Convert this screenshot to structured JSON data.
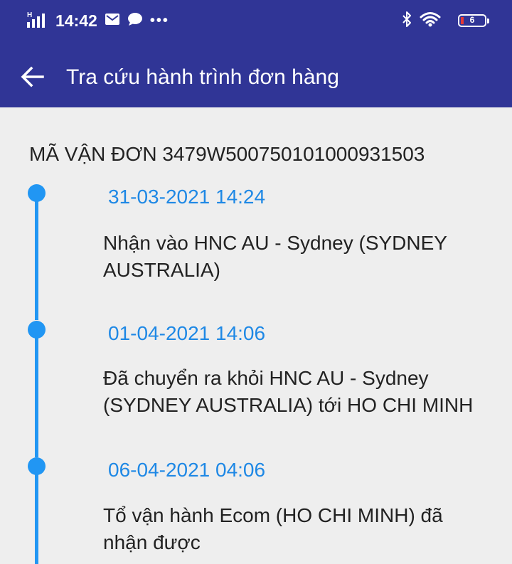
{
  "status_bar": {
    "network_label": "H",
    "time": "14:42",
    "more": "•••",
    "battery_level": "6",
    "icons": [
      "signal-icon",
      "mail-icon",
      "chat-icon",
      "bluetooth-icon",
      "wifi-icon",
      "battery-icon"
    ]
  },
  "app_bar": {
    "title": "Tra cứu hành trình đơn hàng",
    "back_icon": "arrow-left-icon"
  },
  "tracking": {
    "label": "MÃ VẬN ĐƠN 3479W50075010100093150​3"
  },
  "events": [
    {
      "date": "31-03-2021 14:24",
      "description": "Nhận vào HNC AU - Sydney (SYDNEY AUSTRALIA)"
    },
    {
      "date": "01-04-2021 14:06",
      "description": "Đã chuyển ra khỏi HNC AU - Sydney (SYDNEY AUSTRALIA) tới HO CHI MINH"
    },
    {
      "date": "06-04-2021 04:06",
      "description": "Tổ vận hành Ecom (HO CHI MINH) đã nhận được"
    }
  ],
  "colors": {
    "app_bar": "#303596",
    "timeline": "#2196f3",
    "date_text": "#1e88e5",
    "background": "#eeeeee"
  }
}
